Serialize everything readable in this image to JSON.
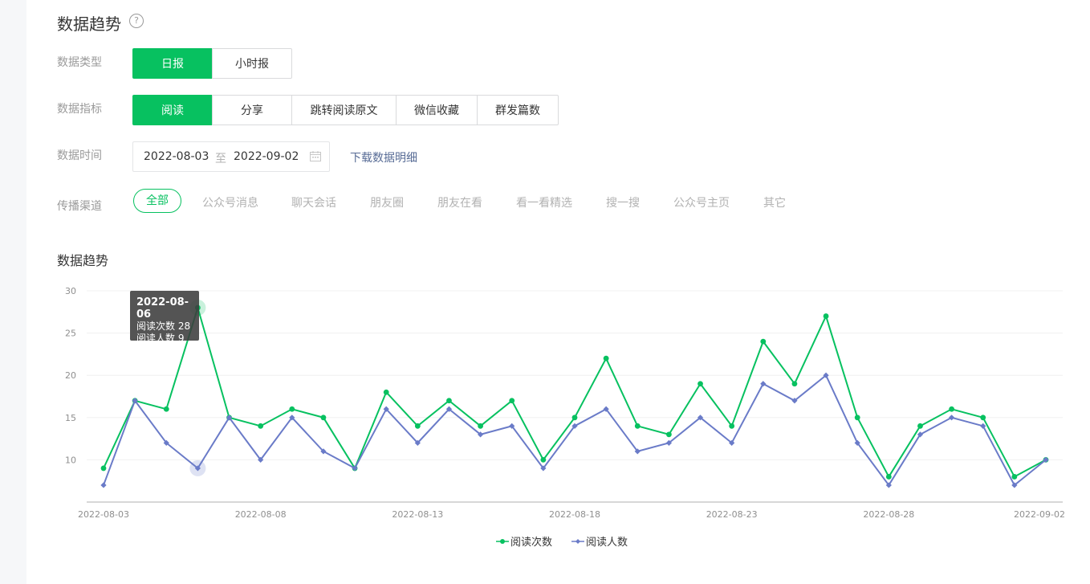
{
  "header": {
    "title": "数据趋势",
    "help_icon": "question-circle-icon"
  },
  "filters": {
    "type_label": "数据类型",
    "type_options": [
      "日报",
      "小时报"
    ],
    "metric_label": "数据指标",
    "metric_options": [
      "阅读",
      "分享",
      "跳转阅读原文",
      "微信收藏",
      "群发篇数"
    ],
    "time_label": "数据时间",
    "date_start": "2022-08-03",
    "date_sep": "至",
    "date_end": "2022-09-02",
    "calendar_icon": "calendar-icon",
    "download_link": "下载数据明细",
    "channel_label": "传播渠道",
    "channels": [
      "全部",
      "公众号消息",
      "聊天会话",
      "朋友圈",
      "朋友在看",
      "看一看精选",
      "搜一搜",
      "公众号主页",
      "其它"
    ]
  },
  "section_title": "数据趋势",
  "colors": {
    "accent": "#07c160",
    "series2": "#6a7bc8",
    "link": "#576b95"
  },
  "tooltip": {
    "date": "2022-08-06",
    "line1": "阅读次数 28",
    "line2": "阅读人数 9"
  },
  "chart_data": {
    "type": "line",
    "x": [
      "2022-08-03",
      "2022-08-04",
      "2022-08-05",
      "2022-08-06",
      "2022-08-07",
      "2022-08-08",
      "2022-08-09",
      "2022-08-10",
      "2022-08-11",
      "2022-08-12",
      "2022-08-13",
      "2022-08-14",
      "2022-08-15",
      "2022-08-16",
      "2022-08-17",
      "2022-08-18",
      "2022-08-19",
      "2022-08-20",
      "2022-08-21",
      "2022-08-22",
      "2022-08-23",
      "2022-08-24",
      "2022-08-25",
      "2022-08-26",
      "2022-08-27",
      "2022-08-28",
      "2022-08-29",
      "2022-08-30",
      "2022-08-31",
      "2022-09-01",
      "2022-09-02"
    ],
    "x_tick_labels": [
      "2022-08-03",
      "2022-08-08",
      "2022-08-13",
      "2022-08-18",
      "2022-08-23",
      "2022-08-28",
      "2022-09-02"
    ],
    "y_ticks": [
      10,
      15,
      20,
      25,
      30
    ],
    "ylim": [
      5,
      30
    ],
    "grid": true,
    "legend_position": "bottom",
    "series": [
      {
        "name": "阅读次数",
        "color": "#07c160",
        "marker": "circle",
        "values": [
          9,
          17,
          16,
          28,
          15,
          14,
          16,
          15,
          9,
          18,
          14,
          17,
          14,
          17,
          10,
          15,
          22,
          14,
          13,
          19,
          14,
          24,
          19,
          27,
          15,
          8,
          14,
          16,
          15,
          8,
          10
        ]
      },
      {
        "name": "阅读人数",
        "color": "#6a7bc8",
        "marker": "diamond",
        "values": [
          7,
          17,
          12,
          9,
          15,
          10,
          15,
          11,
          9,
          16,
          12,
          16,
          13,
          14,
          9,
          14,
          16,
          11,
          12,
          15,
          12,
          19,
          17,
          20,
          12,
          7,
          13,
          15,
          14,
          7,
          10
        ]
      }
    ],
    "highlight_index": 3
  }
}
